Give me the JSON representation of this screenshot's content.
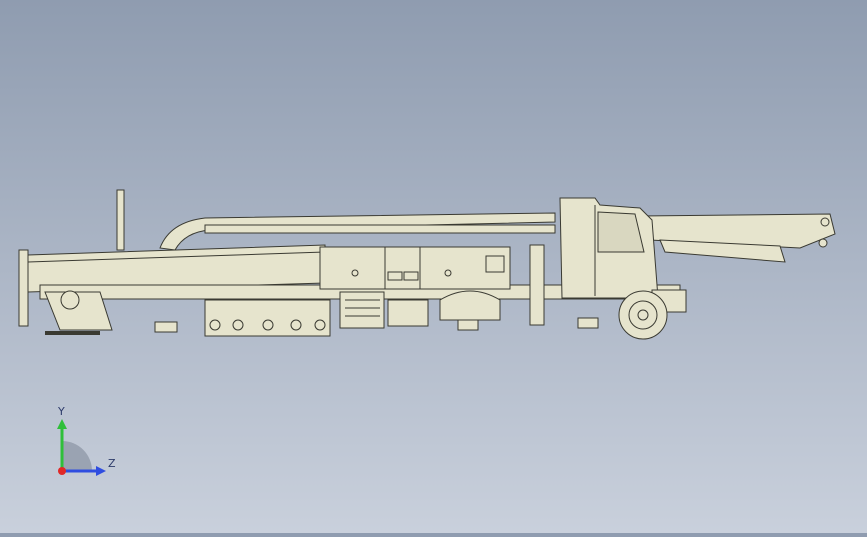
{
  "viewport": {
    "background_top": "#8f9cb0",
    "background_bottom": "#c9d0dc",
    "model_fill": "#e6e4cd",
    "model_line": "#3a3a32"
  },
  "triad": {
    "y_label": "Y",
    "z_label": "Z",
    "y_color": "#2fbf3a",
    "z_color": "#2f4de0",
    "x_color": "#e02828",
    "quadrant_color": "#9aa3b2"
  }
}
